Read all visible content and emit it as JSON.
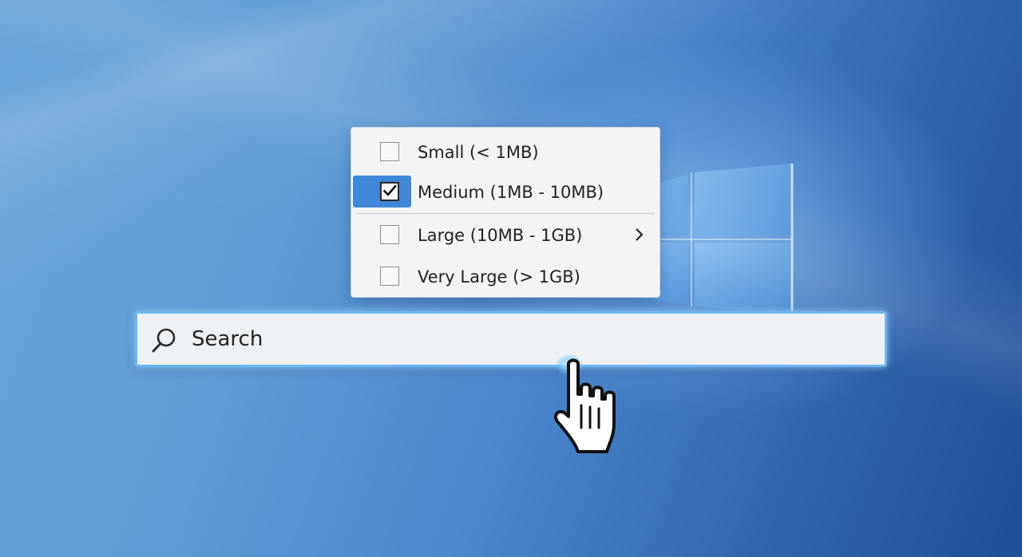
{
  "desktop": {
    "accent_color": "#3f87d8",
    "background_colors": [
      "#6aa6da",
      "#2f66b0",
      "#1f4f96"
    ]
  },
  "size_menu": {
    "items": [
      {
        "label": "Small (< 1MB)",
        "checked": false,
        "highlighted": false,
        "has_submenu": false
      },
      {
        "label": "Medium (1MB - 10MB)",
        "checked": true,
        "highlighted": true,
        "has_submenu": false
      },
      {
        "label": "Large (10MB - 1GB)",
        "checked": false,
        "highlighted": false,
        "has_submenu": true
      },
      {
        "label": "Very Large (> 1GB)",
        "checked": false,
        "highlighted": false,
        "has_submenu": false
      }
    ],
    "submenu_icon": "chevron-right-icon",
    "check_icon": "checkmark-icon"
  },
  "search": {
    "placeholder": "Search",
    "value": "",
    "icon": "search-icon",
    "focus_color": "#6cb6ef"
  },
  "cursor": {
    "type": "hand-pointer-icon"
  }
}
